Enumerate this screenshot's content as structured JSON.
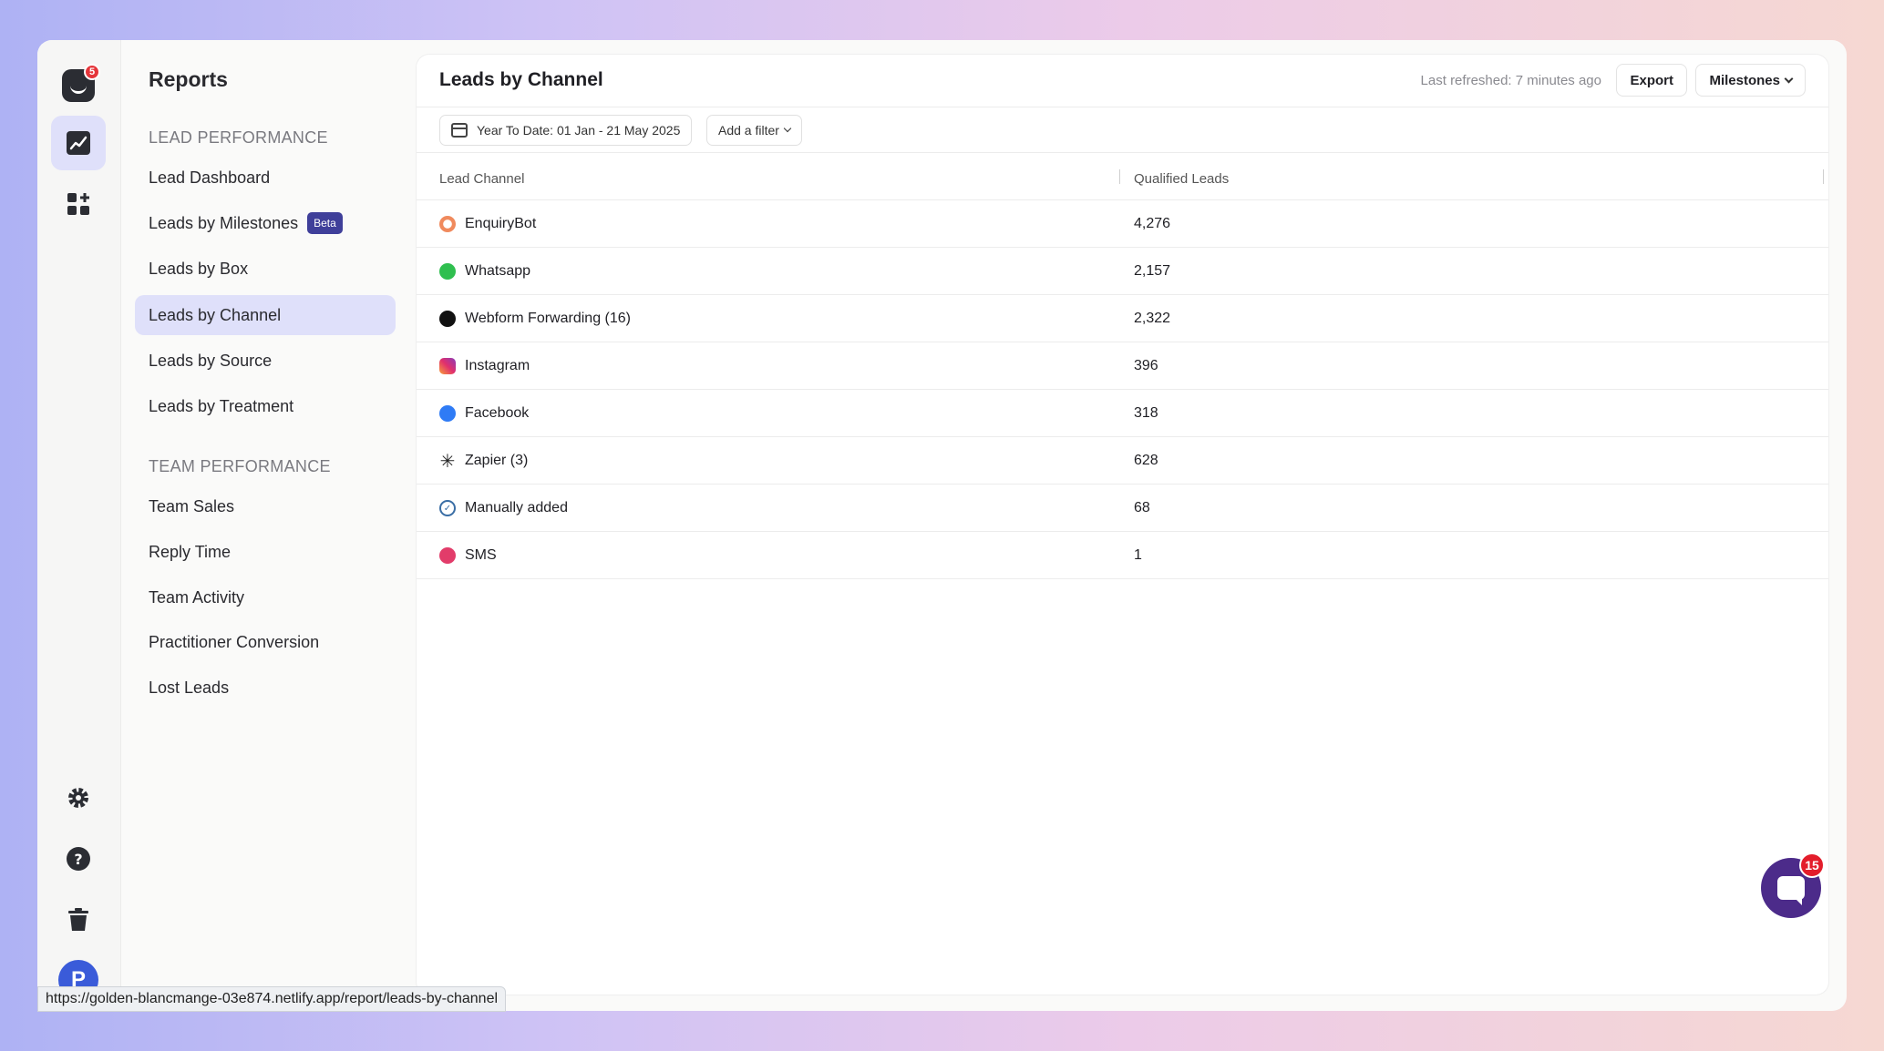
{
  "rail": {
    "logo_badge": "5",
    "avatar_initial": "P"
  },
  "sidebar": {
    "title": "Reports",
    "sections": [
      {
        "label": "LEAD PERFORMANCE",
        "items": [
          {
            "label": "Lead Dashboard"
          },
          {
            "label": "Leads by Milestones",
            "badge": "Beta"
          },
          {
            "label": "Leads by Box"
          },
          {
            "label": "Leads by Channel",
            "active": true
          },
          {
            "label": "Leads by Source"
          },
          {
            "label": "Leads by Treatment"
          }
        ]
      },
      {
        "label": "TEAM PERFORMANCE",
        "items": [
          {
            "label": "Team Sales"
          },
          {
            "label": "Reply Time"
          },
          {
            "label": "Team Activity"
          },
          {
            "label": "Practitioner Conversion"
          },
          {
            "label": "Lost Leads"
          }
        ]
      }
    ]
  },
  "main": {
    "title": "Leads by Channel",
    "last_refreshed": "Last refreshed: 7 minutes ago",
    "export_label": "Export",
    "milestones_label": "Milestones",
    "date_filter": "Year To Date: 01 Jan - 21 May 2025",
    "add_filter": "Add a filter",
    "table": {
      "headers": [
        "Lead Channel",
        "Qualified Leads"
      ],
      "rows": [
        {
          "channel": "EnquiryBot",
          "leads": "4,276",
          "icon": "enquirybot-icon",
          "color": "#f08a5d"
        },
        {
          "channel": "Whatsapp",
          "leads": "2,157",
          "icon": "whatsapp-icon",
          "color": "#2fbf4f"
        },
        {
          "channel": "Webform Forwarding (16)",
          "leads": "2,322",
          "icon": "webform-icon",
          "color": "#111111"
        },
        {
          "channel": "Instagram",
          "leads": "396",
          "icon": "instagram-icon",
          "color": "#e1306c"
        },
        {
          "channel": "Facebook",
          "leads": "318",
          "icon": "messenger-icon",
          "color": "#2f7bf5"
        },
        {
          "channel": "Zapier (3)",
          "leads": "628",
          "icon": "zapier-icon",
          "color": "#222222"
        },
        {
          "channel": "Manually added",
          "leads": "68",
          "icon": "check-circle-icon",
          "color": "#3a6ea5"
        },
        {
          "channel": "SMS",
          "leads": "1",
          "icon": "sms-icon",
          "color": "#e23c6a"
        }
      ]
    }
  },
  "chat": {
    "badge": "15"
  },
  "status_url": "https://golden-blancmange-03e874.netlify.app/report/leads-by-channel"
}
